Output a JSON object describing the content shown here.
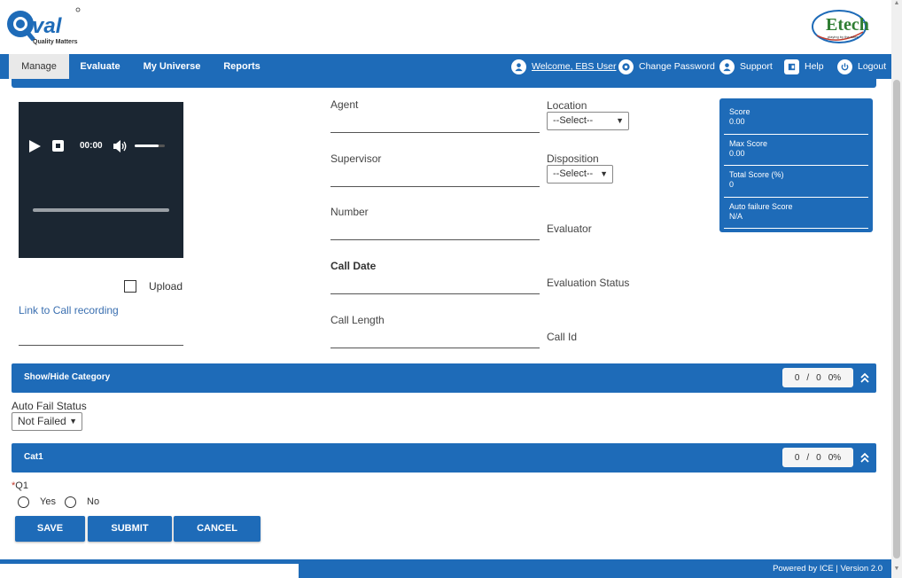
{
  "header": {
    "qval_logo_text": "Q:val",
    "qval_tagline": "Quality Matters",
    "etech_logo_text": "Etech",
    "etech_tagline": "playing by the rules"
  },
  "nav": {
    "items": [
      "Manage",
      "Evaluate",
      "My Universe",
      "Reports"
    ],
    "active": "Manage",
    "welcome": "Welcome, EBS User",
    "change_password": "Change Password",
    "support": "Support",
    "help": "Help",
    "logout": "Logout"
  },
  "player": {
    "time": "00:00",
    "volume_level": 0.8,
    "progress": 0
  },
  "upload_label": "Upload",
  "link_call_recording": "Link to Call recording",
  "form": {
    "agent": "Agent",
    "supervisor": "Supervisor",
    "number": "Number",
    "call_date": "Call Date",
    "call_length": "Call Length",
    "location": "Location",
    "location_value": "--Select--",
    "disposition": "Disposition",
    "disposition_value": "--Select--",
    "evaluator": "Evaluator",
    "evaluation_status": "Evaluation Status",
    "call_id": "Call Id"
  },
  "score_panel": {
    "score_label": "Score",
    "score_value": "0.00",
    "max_score_label": "Max Score",
    "max_score_value": "0.00",
    "total_score_label": "Total Score (%)",
    "total_score_value": "0",
    "auto_failure_label": "Auto failure Score",
    "auto_failure_value": "N/A"
  },
  "show_hide": {
    "title": "Show/Hide Category",
    "score": "0",
    "sep": "/",
    "max": "0",
    "pct": "0%"
  },
  "auto_fail": {
    "label": "Auto Fail Status",
    "value": "Not Failed"
  },
  "cat1": {
    "title": "Cat1",
    "score": "0",
    "sep": "/",
    "max": "0",
    "pct": "0%"
  },
  "q1": {
    "required_mark": "*",
    "label": "Q1",
    "yes": "Yes",
    "no": "No"
  },
  "buttons": {
    "save": "SAVE",
    "submit": "SUBMIT",
    "cancel": "CANCEL"
  },
  "footer": {
    "text": "Powered by ICE | Version 2.0"
  },
  "colors": {
    "primary": "#1e6bb8",
    "player_bg": "#1b2632"
  }
}
